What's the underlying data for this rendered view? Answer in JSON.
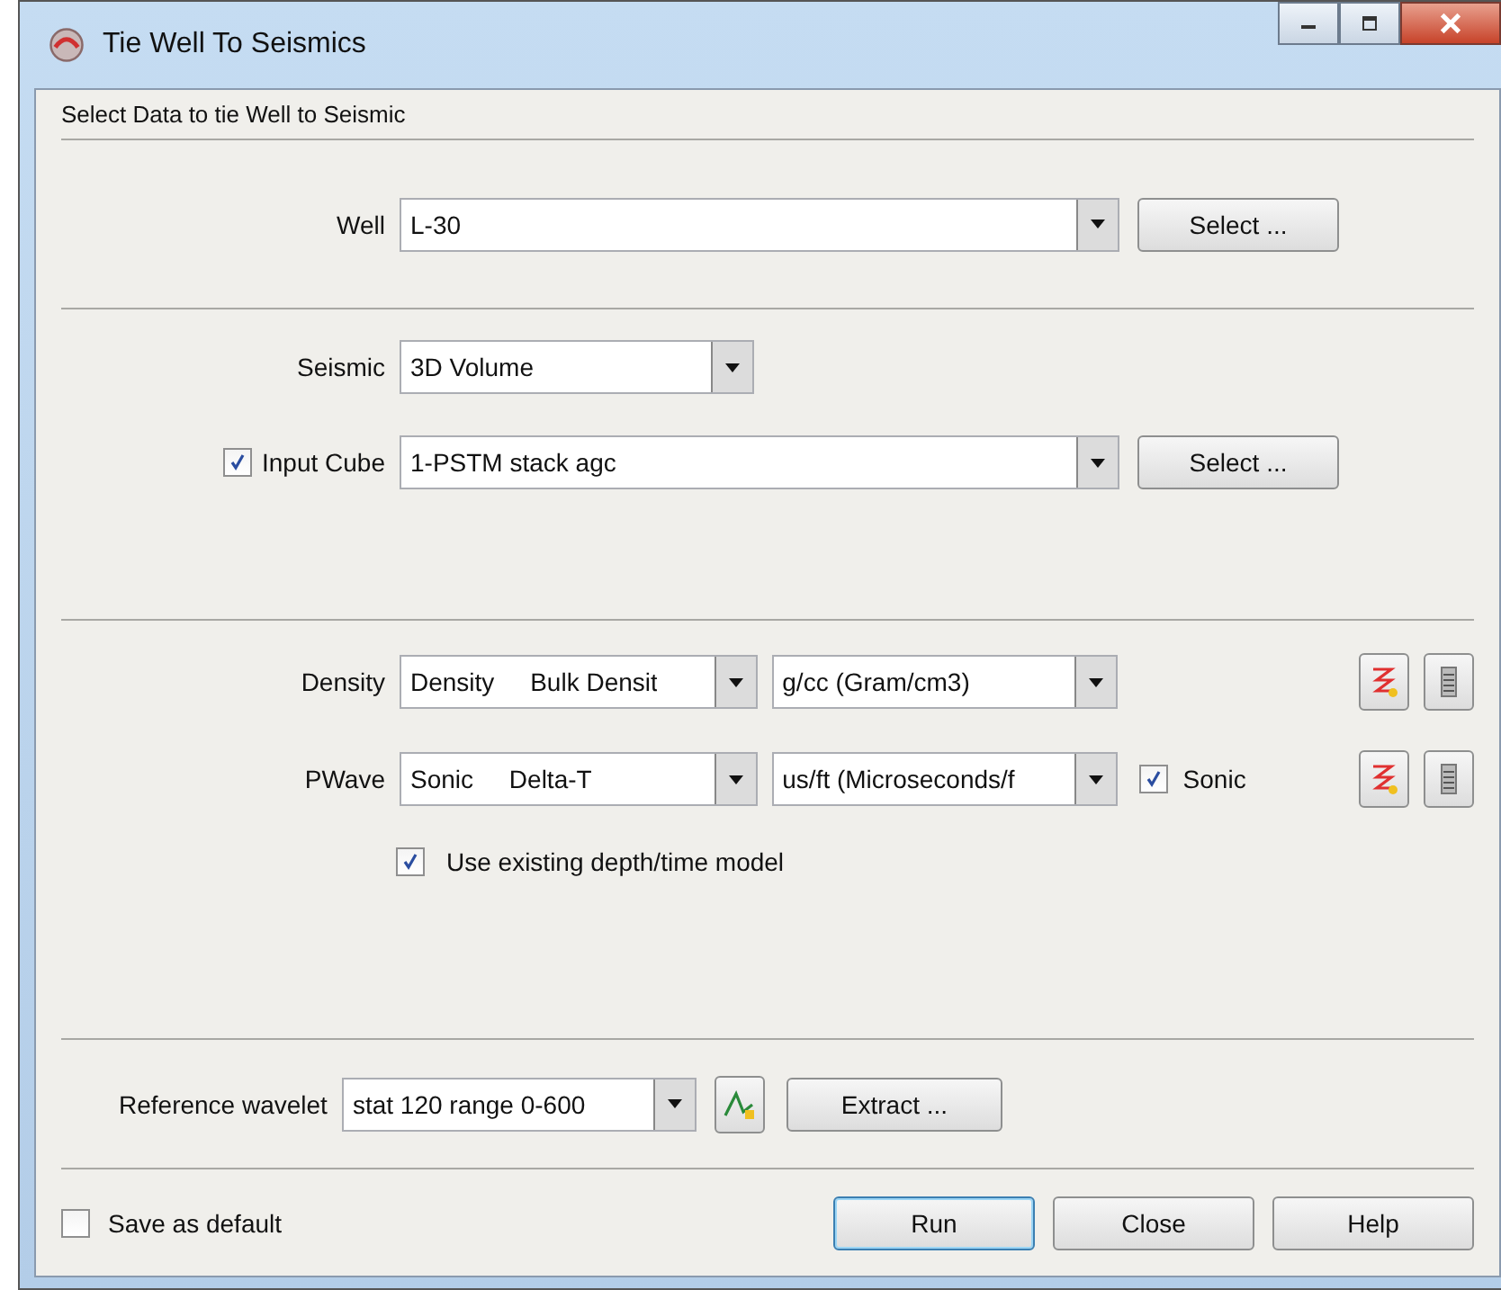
{
  "window": {
    "title": "Tie Well To Seismics"
  },
  "header": "Select Data to tie Well to Seismic",
  "well": {
    "label": "Well",
    "value": "L-30",
    "button": "Select ..."
  },
  "seismic": {
    "label": "Seismic",
    "value": "3D Volume"
  },
  "input_cube": {
    "label": "Input Cube",
    "checked": true,
    "value": "1-PSTM stack agc",
    "button": "Select ..."
  },
  "logs": [
    {
      "label": "Density",
      "log_type": "Density",
      "log_name": "Bulk Densit",
      "unit": "g/cc (Gram/cm3)"
    },
    {
      "label": "PWave",
      "log_type": "Sonic",
      "log_name": "Delta-T",
      "unit": "us/ft (Microseconds/f",
      "option": {
        "label": "Sonic",
        "checked": true
      }
    }
  ],
  "depth_time": {
    "label": "Use existing depth/time model",
    "checked": true
  },
  "wavelet": {
    "label": "Reference wavelet",
    "value": "stat 120 range 0-600",
    "button": "Extract ..."
  },
  "save_default": {
    "label": "Save as default",
    "checked": false
  },
  "buttons": [
    {
      "label": "Run",
      "default": true
    },
    {
      "label": "Close",
      "default": false
    },
    {
      "label": "Help",
      "default": false
    }
  ]
}
